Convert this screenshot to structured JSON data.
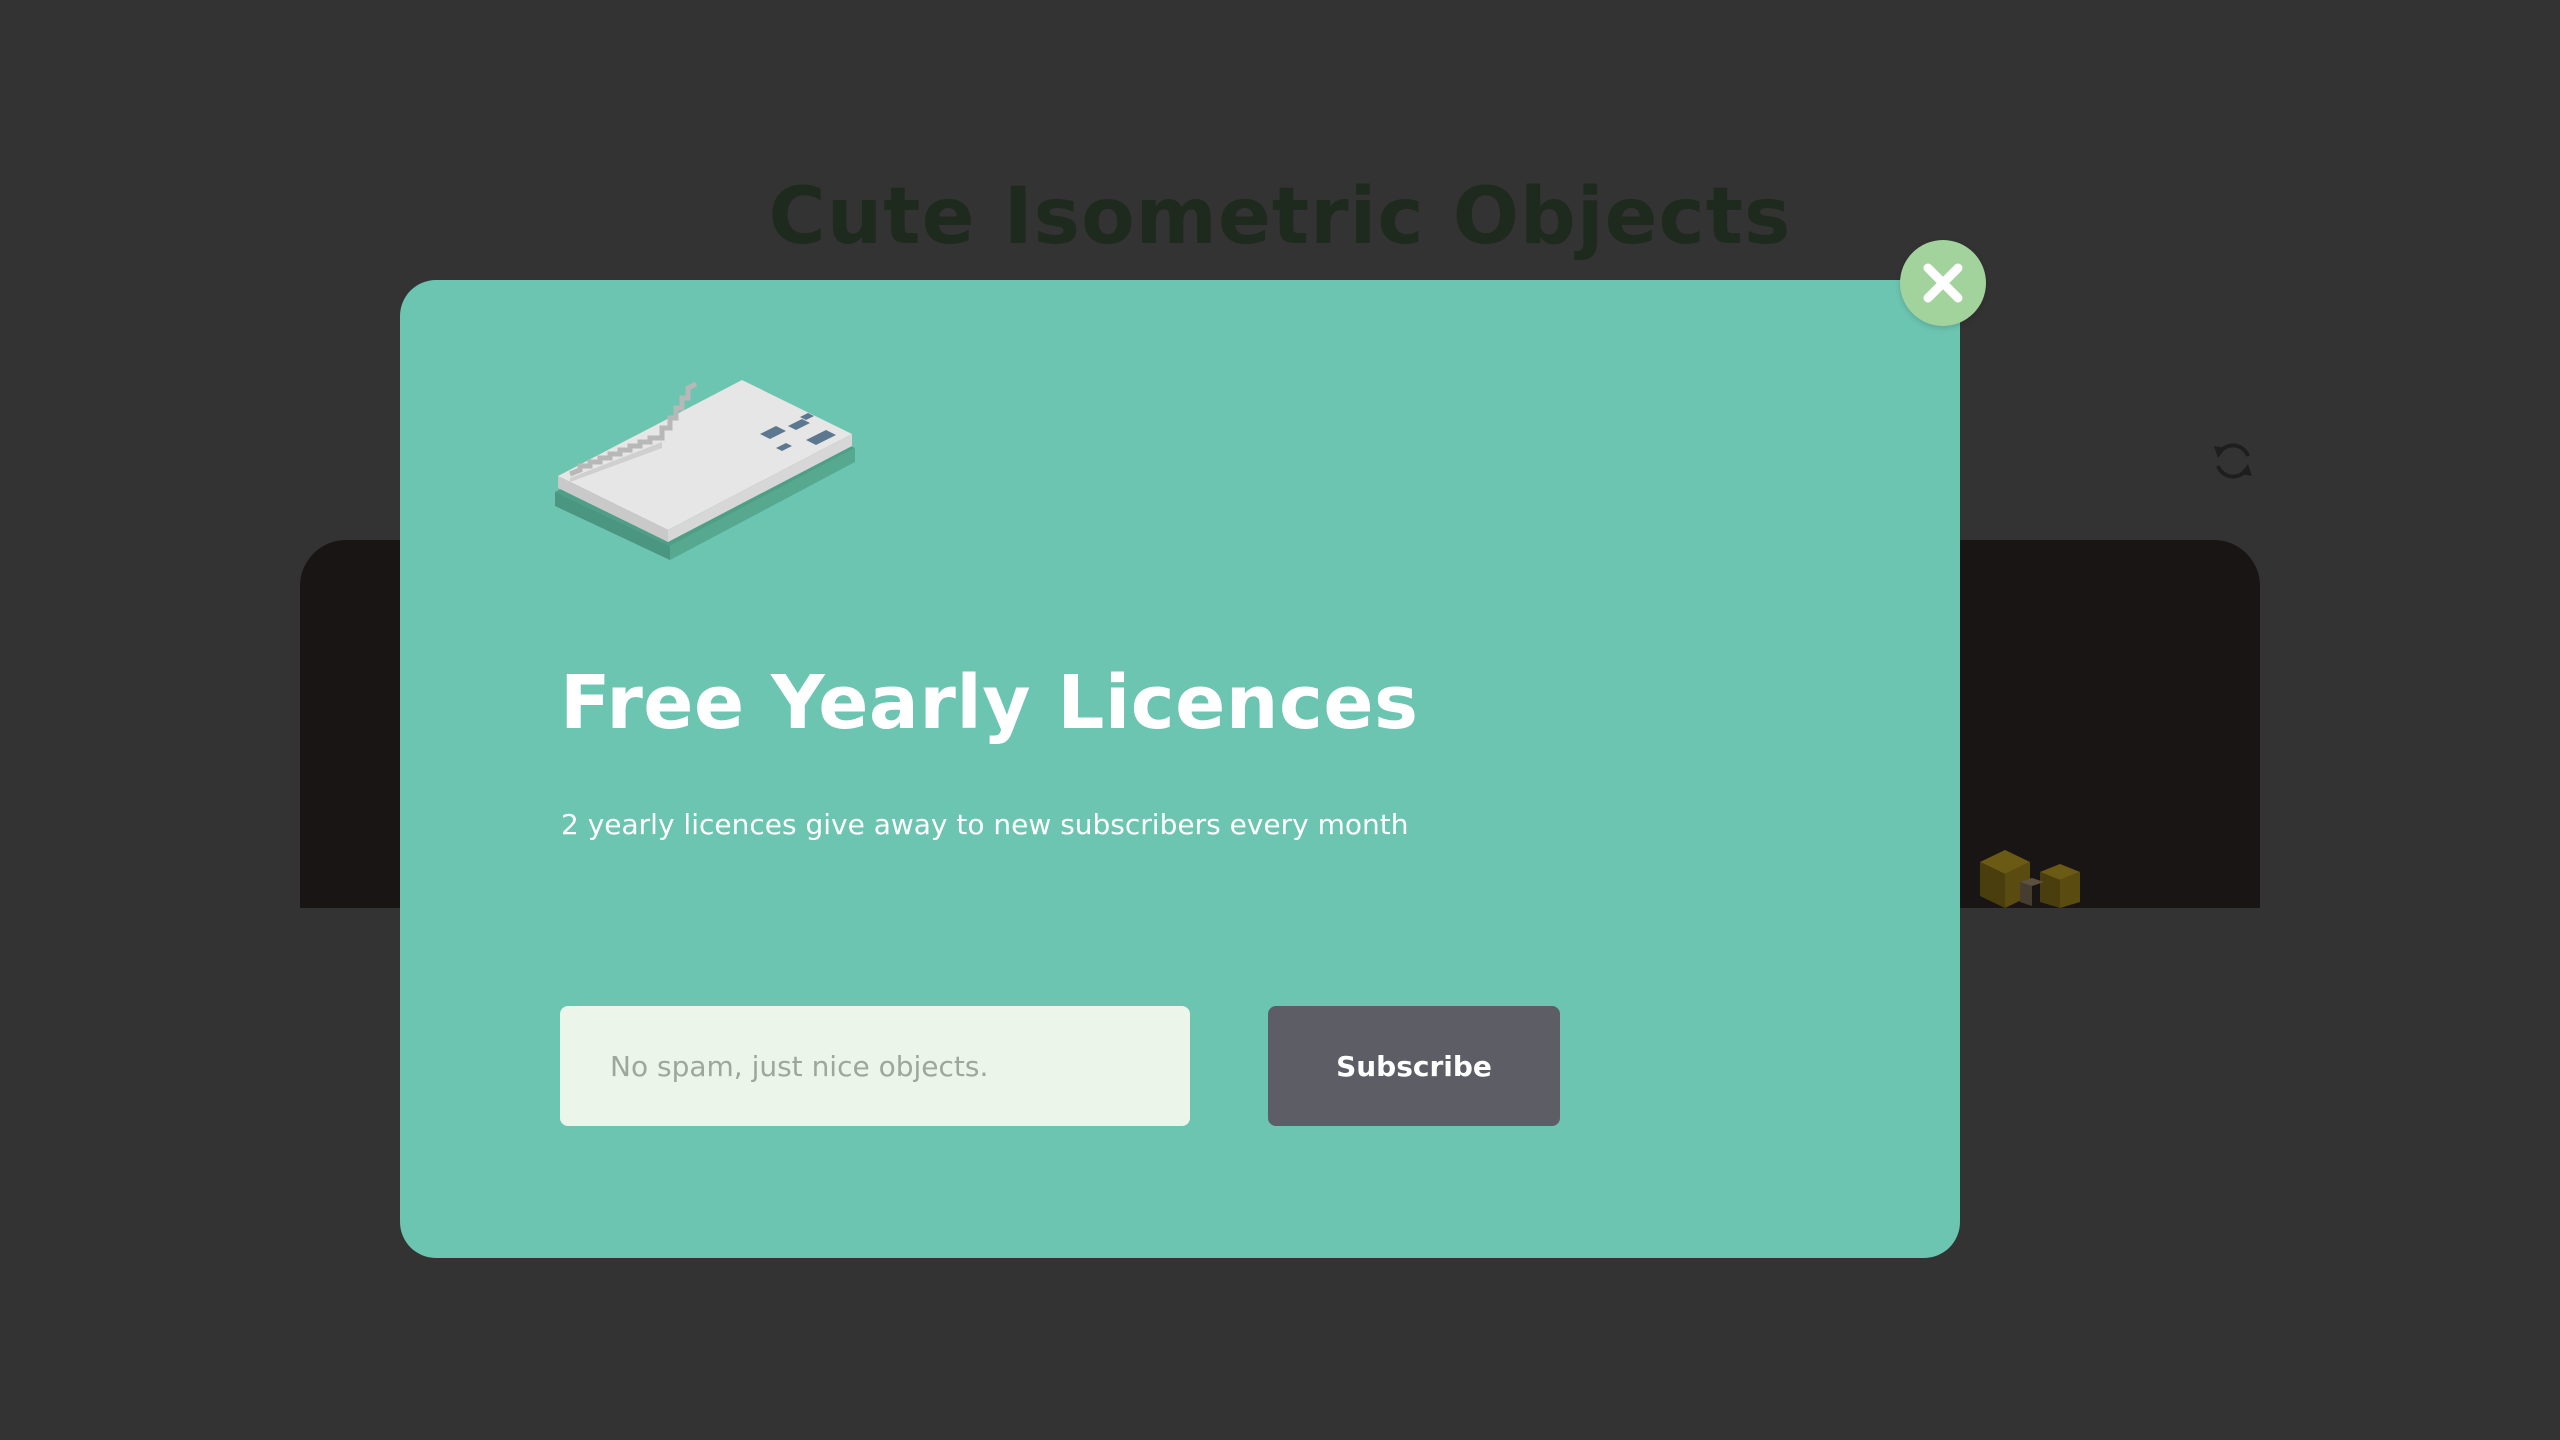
{
  "background": {
    "title": "Cute Isometric Objects",
    "refresh_icon": "refresh-icon"
  },
  "modal": {
    "heading": "Free Yearly Licences",
    "subtitle": "2 yearly licences give away to new subscribers every month",
    "email_placeholder": "No spam, just nice objects.",
    "subscribe_label": "Subscribe",
    "close_icon": "close-icon",
    "illustration": "envelope-icon"
  },
  "colors": {
    "overlay_background": "#333333",
    "modal_background": "#6cc5b1",
    "close_button": "#a3d39c",
    "input_background": "#ebf5ea",
    "subscribe_button": "#5c5d65",
    "title_text": "#1f2a1f"
  }
}
